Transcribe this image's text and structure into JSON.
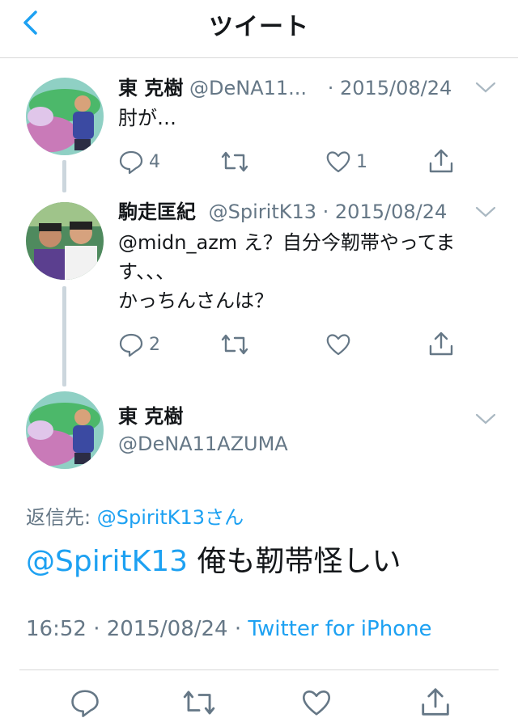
{
  "nav": {
    "title": "ツイート",
    "back_icon": "chevron-left-icon"
  },
  "tweets": [
    {
      "name": "東 克樹",
      "handle": "@DeNA11...",
      "date": "· 2015/08/24",
      "text": "肘が…",
      "reply_count": "4",
      "like_count": "1"
    },
    {
      "name": "駒走匡紀",
      "handle": "@SpiritK13",
      "date": "· 2015/08/24",
      "mention": "@midn_azm",
      "text_line1": " え？自分今靭帯やってま",
      "text_line2": "す、、、",
      "text_line3": "かっちんさんは？",
      "reply_count": "2"
    }
  ],
  "main": {
    "name": "東 克樹",
    "handle": "@DeNA11AZUMA",
    "reply_prefix": "返信先: ",
    "reply_to": "@SpiritK13さん",
    "mention": "@SpiritK13",
    "text": " 俺も靭帯怪しい",
    "time": "16:52 · 2015/08/24 · ",
    "source": "Twitter for iPhone"
  },
  "colors": {
    "accent": "#1da1f2",
    "secondary": "#657786",
    "icon": "#657786"
  }
}
